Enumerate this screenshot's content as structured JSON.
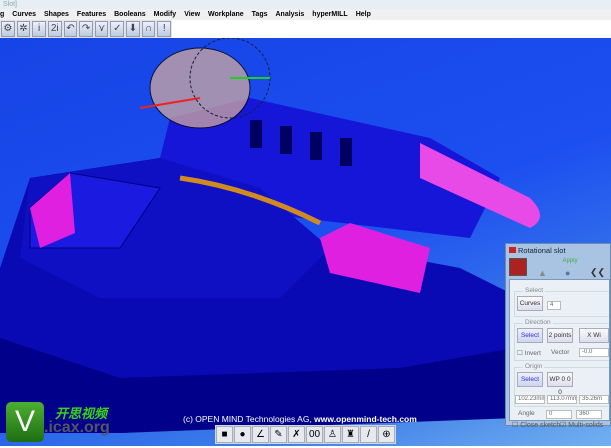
{
  "window": {
    "title": "Slot]"
  },
  "menu": [
    "g",
    "Curves",
    "Shapes",
    "Features",
    "Booleans",
    "Modify",
    "View",
    "Workplane",
    "Tags",
    "Analysis",
    "hyperMILL",
    "Help"
  ],
  "toolbar": [
    {
      "icon": "gear-icon",
      "g": "⚙"
    },
    {
      "icon": "gears-icon",
      "g": "✲"
    },
    {
      "icon": "info-icon",
      "g": "i"
    },
    {
      "icon": "info2-icon",
      "g": "2i"
    },
    {
      "icon": "undo-icon",
      "g": "↶"
    },
    {
      "icon": "redo-icon",
      "g": "↷"
    },
    {
      "icon": "filter-icon",
      "g": "⋎"
    },
    {
      "icon": "check-icon",
      "g": "✓"
    },
    {
      "icon": "download-icon",
      "g": "⬇"
    },
    {
      "icon": "magnet-icon",
      "g": "∩"
    },
    {
      "icon": "warning-icon",
      "g": "!"
    }
  ],
  "copyright": {
    "prefix": "(c) OPEN MIND Technologies AG, ",
    "url": "www.openmind-tech.com"
  },
  "bottom_tools": [
    {
      "icon": "shade-icon",
      "g": "■"
    },
    {
      "icon": "sphere-icon",
      "g": "●"
    },
    {
      "icon": "angle-icon",
      "g": "∠"
    },
    {
      "icon": "brush-icon",
      "g": "✎"
    },
    {
      "icon": "pin-icon",
      "g": "✗"
    },
    {
      "icon": "counter-icon",
      "g": "00"
    },
    {
      "icon": "person-icon",
      "g": "♙"
    },
    {
      "icon": "tower-icon",
      "g": "♜"
    },
    {
      "icon": "pencil-icon",
      "g": "/"
    },
    {
      "icon": "grid-icon",
      "g": "⊕"
    }
  ],
  "watermark": {
    "cn": "开思视频",
    "url": ".icax.org",
    "letter": "V"
  },
  "dialog": {
    "title": "Rotational slot",
    "apply": "Apply",
    "select_group": "Select",
    "curves_btn": "Curves",
    "curves_count": "4",
    "direction_group": "Direction",
    "select_btn": "Select",
    "two_points_btn": "2 points",
    "x_btn": "X Wi",
    "invert_label": "Invert",
    "vector_label": "Vector",
    "vector_value": "-0.0",
    "origin_group": "Origin",
    "origin_select_btn": "Select",
    "wp_btn": "WP 0 0 0",
    "coords": [
      "102.23mm",
      "113.07mm",
      "35.26m"
    ],
    "angle_label": "Angle",
    "angle_from": "0",
    "angle_to": "360",
    "close_sketch": "Close sketch",
    "multi_solids": "Multi-solids"
  },
  "colors": {
    "viewport": "#1c4ff0",
    "part": "#1010c8",
    "highlight": "#e020e0"
  }
}
